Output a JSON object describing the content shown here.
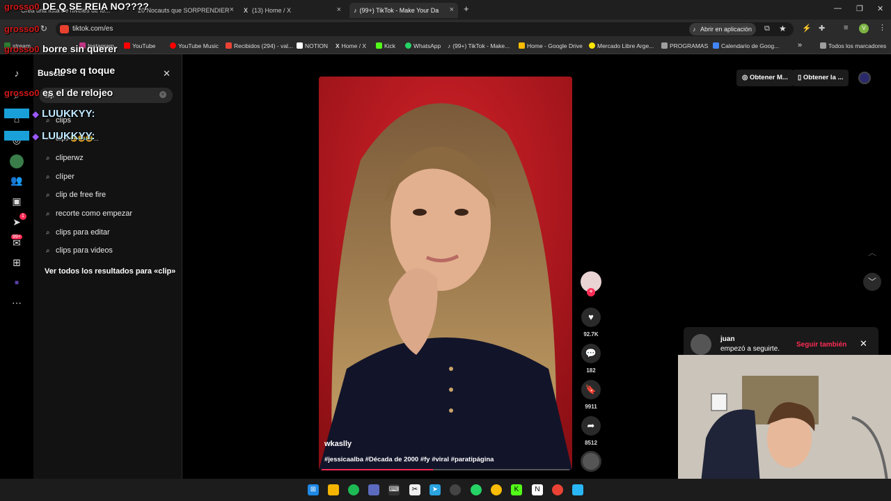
{
  "browser": {
    "tabs": [
      {
        "title": "Crea una lista de niveles de lo...",
        "active": false
      },
      {
        "title": "20 Nocauts que SORPRENDIER",
        "active": false
      },
      {
        "title": "(13) Home / X",
        "active": false
      },
      {
        "title": "(99+) TikTok - Make Your Da",
        "active": true
      }
    ],
    "new_tab": "+",
    "url": "tiktok.com/es",
    "open_app_label": "Abrir en aplicación",
    "bookmarks": [
      {
        "label": "stream",
        "color": "#2e7d32"
      },
      {
        "label": "Instagram",
        "color": "#c13584"
      },
      {
        "label": "YouTube",
        "color": "#ff0000"
      },
      {
        "label": "YouTube Music",
        "color": "#ff0000"
      },
      {
        "label": "Recibidos (294) - val...",
        "color": "#ea4335"
      },
      {
        "label": "NOTION",
        "color": "#ffffff"
      },
      {
        "label": "Home / X",
        "color": "#000000"
      },
      {
        "label": "Kick",
        "color": "#53fc18"
      },
      {
        "label": "WhatsApp",
        "color": "#25d366"
      },
      {
        "label": "(99+) TikTok - Make...",
        "color": "#000000"
      },
      {
        "label": "Home - Google Drive",
        "color": "#fbbc04"
      },
      {
        "label": "Mercado Libre Arge...",
        "color": "#ffe600"
      },
      {
        "label": "PROGRAMAS",
        "color": "#9e9e9e"
      },
      {
        "label": "Calendario de Goog...",
        "color": "#4285f4"
      }
    ],
    "bookmarks_more": "»",
    "all_bookmarks": "Todos los marcadores"
  },
  "search": {
    "title": "Buscar",
    "query": "clip",
    "suggestions": [
      "clips",
      "clips 😂😂😂...",
      "cliperwz",
      "clíper",
      "clip de free fire",
      "recorte como empezar",
      "clips para editar",
      "clips para videos"
    ],
    "see_all": "Ver todos los resultados para «clip»"
  },
  "chat_overlay": [
    {
      "user": "grosso0",
      "message": "DE Q SE REIA NO????"
    },
    {
      "user": "grosso0",
      "message": ""
    },
    {
      "user": "grosso0",
      "message": "borre sin querer"
    },
    {
      "user": "",
      "message": "nose q toque"
    },
    {
      "user": "grosso0",
      "message": "es el de relojeo"
    },
    {
      "user": "LUUKKYY:",
      "message": ""
    },
    {
      "user": "LUUKKYY:",
      "message": ""
    }
  ],
  "video": {
    "author": "wkaslly",
    "tags": "#jessicaalba #Década de 2000 #fy #viral #paratipágina",
    "progress": 0.45
  },
  "actions": {
    "likes": "92.7K",
    "comments": "182",
    "saves": "9911",
    "shares": "8512"
  },
  "topright": {
    "get_coins": "Obtener M...",
    "get_app": "Obtener la ..."
  },
  "notification": {
    "user": "juan",
    "text": "empezó a seguirte.",
    "action": "Seguir también"
  },
  "sidebar_badges": {
    "messages": "1",
    "inbox": "99+"
  },
  "colors": {
    "accent": "#fe2c55",
    "chat_user": "#d01818",
    "video_bg": "#b2181c"
  }
}
